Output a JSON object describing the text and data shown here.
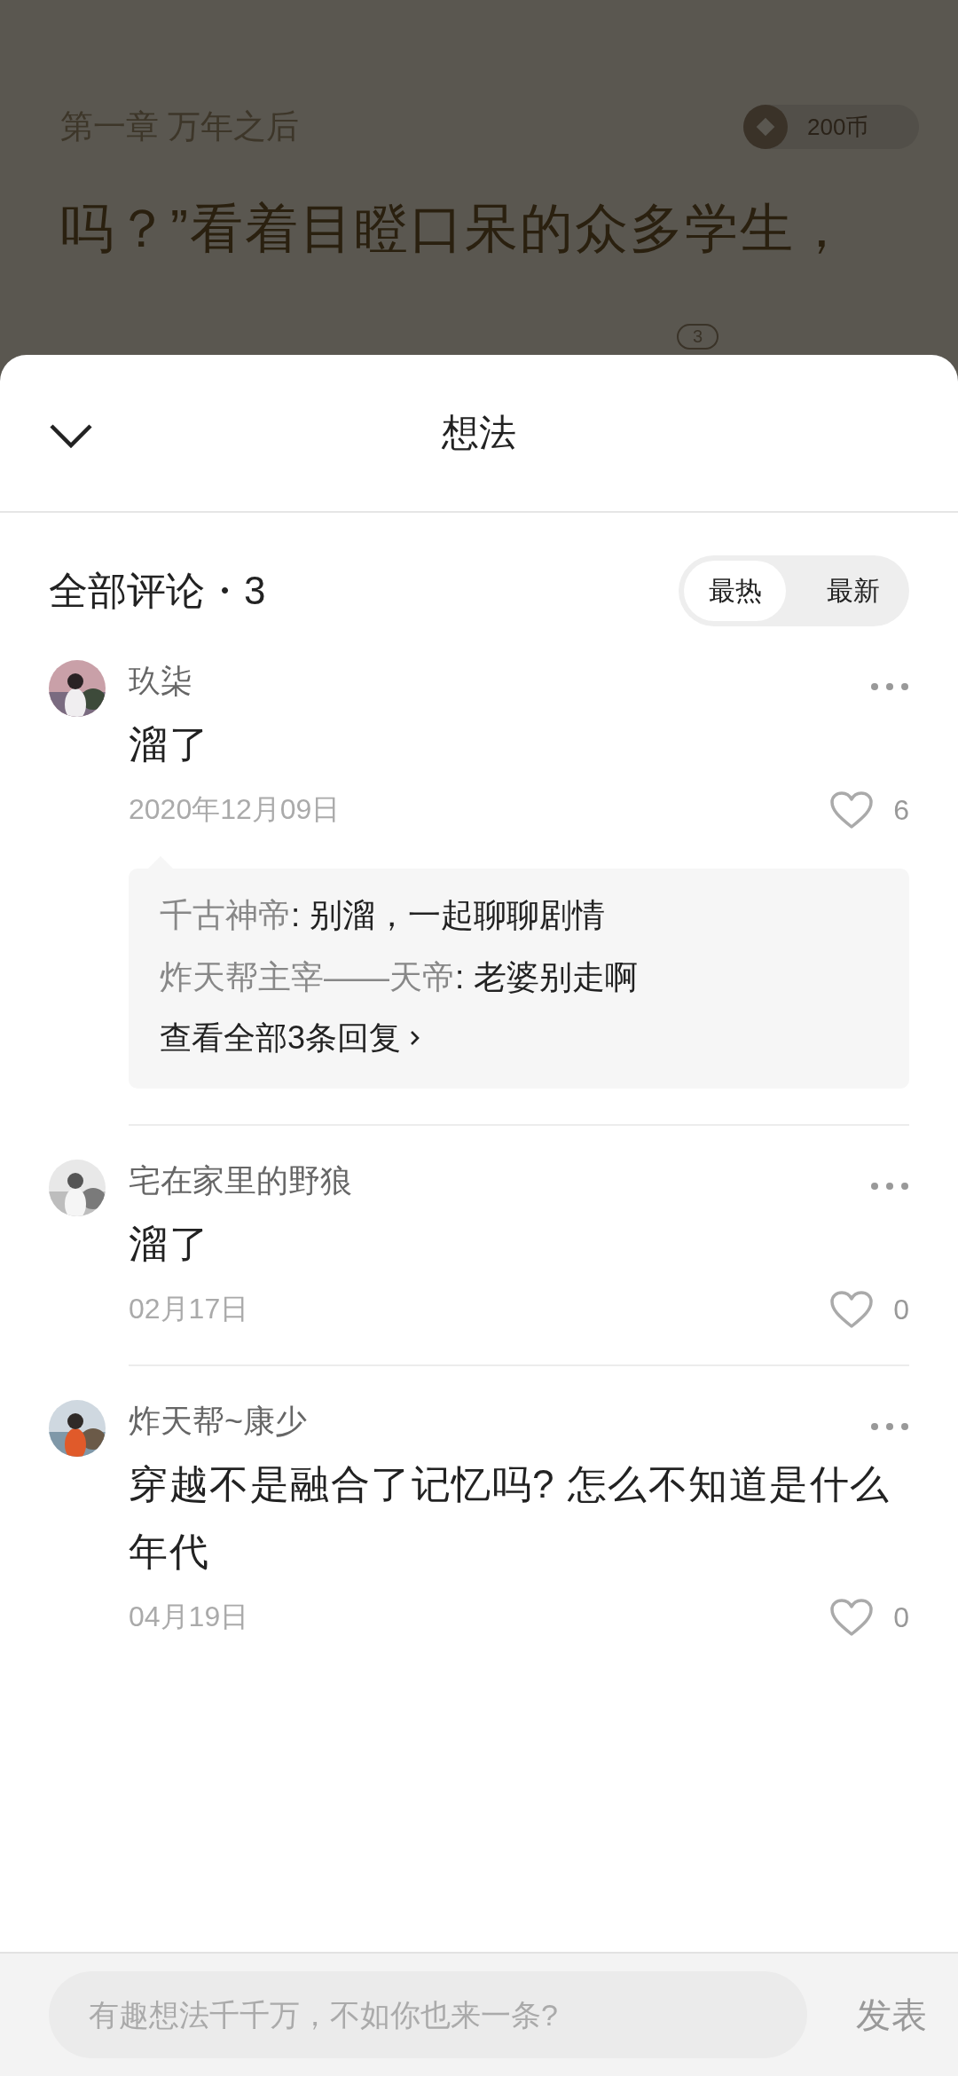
{
  "reader": {
    "chapter_title": "第一章 万年之后",
    "coins": "200币",
    "lines": [
      "吗？”看着目瞪口呆的众多学生，"
    ],
    "idea_count": "3"
  },
  "sheet": {
    "title": "想法"
  },
  "comments_header": {
    "title": "全部评论・3",
    "sort_tabs": [
      {
        "label": "最热",
        "selected": true
      },
      {
        "label": "最新",
        "selected": false
      }
    ]
  },
  "comments": [
    {
      "user": "玖柒",
      "text": "溜了",
      "date": "2020年12月09日",
      "likes": "6",
      "replies": [
        {
          "user": "千古神帝",
          "text": ": 别溜，一起聊聊剧情"
        },
        {
          "user": "炸天帮主宰——天帝",
          "text": ": 老婆别走啊"
        }
      ],
      "more_replies": "查看全部3条回复"
    },
    {
      "user": "宅在家里的野狼",
      "text": "溜了",
      "date": "02月17日",
      "likes": "0"
    },
    {
      "user": "炸天帮~康少",
      "text": "穿越不是融合了记忆吗? 怎么不知道是什么年代",
      "date": "04月19日",
      "likes": "0"
    }
  ],
  "composer": {
    "placeholder": "有趣想法千千万，不如你也来一条?",
    "submit": "发表"
  }
}
